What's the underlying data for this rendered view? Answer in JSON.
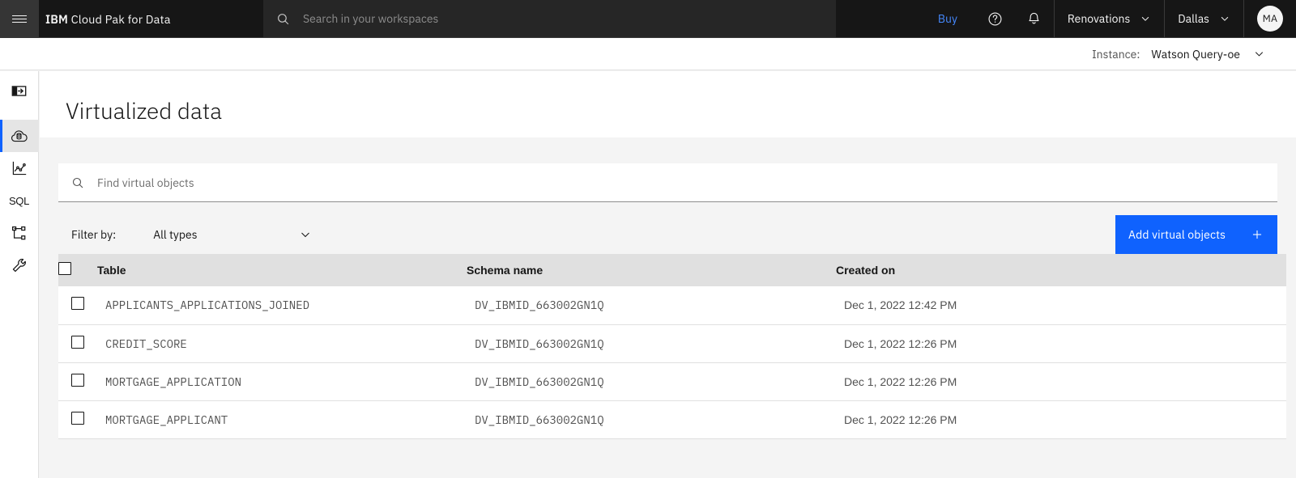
{
  "header": {
    "menu_icon": "hamburger-menu-icon",
    "brand_bold": "IBM",
    "brand_rest": "Cloud Pak for Data",
    "search": {
      "placeholder": "Search in your workspaces",
      "value": "",
      "icon": "search-icon"
    },
    "buy_label": "Buy",
    "help_icon": "help-circle-icon",
    "notification_icon": "bell-icon",
    "project_menu": "Renovations",
    "region_menu": "Dallas",
    "avatar_initials": "MA",
    "colors": {
      "header_bg": "#161616",
      "search_bg": "#262626",
      "buy_link": "#4589ff"
    }
  },
  "instance_bar": {
    "label": "Instance:",
    "value": "Watson Query-oe",
    "chevron_icon": "chevron-down-icon"
  },
  "sidebar": {
    "items": [
      {
        "name": "open-panel",
        "icon": "open-panel-icon",
        "label": "Open panel",
        "active": false
      },
      {
        "name": "virtualized-data",
        "icon": "cloud-database-icon",
        "label": "Virtualized data",
        "active": true
      },
      {
        "name": "analytics",
        "icon": "chart-line-data-icon",
        "label": "Analytics",
        "active": false
      },
      {
        "name": "sql-editor",
        "icon": "sql-text-icon",
        "label": "SQL",
        "active": false
      },
      {
        "name": "data-sources",
        "icon": "hierarchy-tree-icon",
        "label": "Data sources",
        "active": false
      },
      {
        "name": "service-settings",
        "icon": "wrench-icon",
        "label": "Service settings",
        "active": false
      }
    ]
  },
  "main": {
    "page_title": "Virtualized data",
    "search": {
      "placeholder": "Find virtual objects",
      "value": "",
      "icon": "search-icon"
    },
    "toolbar": {
      "filter_label": "Filter by:",
      "filter_value": "All types",
      "filter_chevron": "chevron-down-icon",
      "add_button_label": "Add virtual objects",
      "add_button_icon": "plus-icon",
      "add_button_color": "#0f62fe"
    },
    "table": {
      "columns": [
        "Table",
        "Schema name",
        "Created on"
      ],
      "select_all_checkbox": false,
      "rows": [
        {
          "selected": false,
          "table": "APPLICANTS_APPLICATIONS_JOINED",
          "schema": "DV_IBMID_663002GN1Q",
          "created_on": "Dec 1, 2022 12:42 PM",
          "overflow_icon": "overflow-menu-vertical-icon"
        },
        {
          "selected": false,
          "table": "CREDIT_SCORE",
          "schema": "DV_IBMID_663002GN1Q",
          "created_on": "Dec 1, 2022 12:26 PM",
          "overflow_icon": "overflow-menu-vertical-icon"
        },
        {
          "selected": false,
          "table": "MORTGAGE_APPLICATION",
          "schema": "DV_IBMID_663002GN1Q",
          "created_on": "Dec 1, 2022 12:26 PM",
          "overflow_icon": "overflow-menu-vertical-icon"
        },
        {
          "selected": false,
          "table": "MORTGAGE_APPLICANT",
          "schema": "DV_IBMID_663002GN1Q",
          "created_on": "Dec 1, 2022 12:26 PM",
          "overflow_icon": "overflow-menu-vertical-icon"
        }
      ]
    }
  }
}
